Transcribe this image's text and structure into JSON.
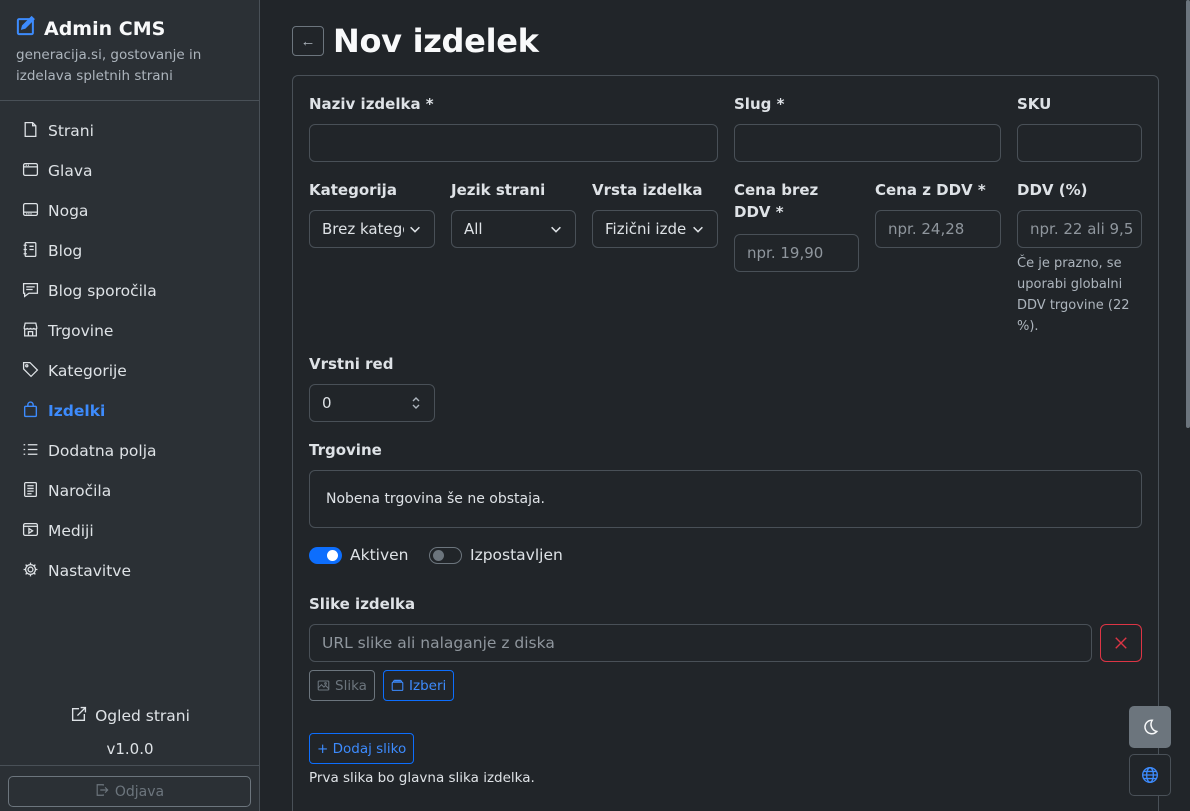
{
  "sidebar": {
    "brand_title": "Admin CMS",
    "brand_subtitle": "generacija.si, gostovanje in izdelava spletnih strani",
    "items": [
      {
        "label": "Strani",
        "icon": "file-icon"
      },
      {
        "label": "Glava",
        "icon": "window-icon"
      },
      {
        "label": "Noga",
        "icon": "window-dots-icon"
      },
      {
        "label": "Blog",
        "icon": "journal-icon"
      },
      {
        "label": "Blog sporočila",
        "icon": "chat-icon"
      },
      {
        "label": "Trgovine",
        "icon": "shop-icon"
      },
      {
        "label": "Kategorije",
        "icon": "tags-icon"
      },
      {
        "label": "Izdelki",
        "icon": "bag-icon",
        "active": true
      },
      {
        "label": "Dodatna polja",
        "icon": "list-icon"
      },
      {
        "label": "Naročila",
        "icon": "receipt-icon"
      },
      {
        "label": "Mediji",
        "icon": "play-icon"
      },
      {
        "label": "Nastavitve",
        "icon": "gear-icon"
      }
    ],
    "preview_label": "Ogled strani",
    "version": "v1.0.0",
    "logout_label": "Odjava"
  },
  "header": {
    "back_symbol": "←",
    "title": "Nov izdelek"
  },
  "form": {
    "name_label": "Naziv izdelka *",
    "name_value": "",
    "slug_label": "Slug *",
    "slug_value": "",
    "sku_label": "SKU",
    "sku_value": "",
    "category_label": "Kategorija",
    "category_value": "Brez kategorije",
    "language_label": "Jezik strani",
    "language_value": "All",
    "type_label": "Vrsta izdelka",
    "type_value": "Fizični izdelek",
    "price_net_label": "Cena brez DDV *",
    "price_net_placeholder": "npr. 19,90",
    "price_gross_label": "Cena z DDV *",
    "price_gross_placeholder": "npr. 24,28",
    "vat_label": "DDV (%)",
    "vat_placeholder": "npr. 22 ali 9,5",
    "vat_hint": "Če je prazno, se uporabi globalni DDV trgovine (22 %).",
    "order_label": "Vrstni red",
    "order_value": "0",
    "stores_label": "Trgovine",
    "stores_empty": "Nobena trgovina še ne obstaja.",
    "active_label": "Aktiven",
    "active_on": true,
    "featured_label": "Izpostavljen",
    "featured_on": false,
    "images_label": "Slike izdelka",
    "image_url_placeholder": "URL slike ali nalaganje z diska",
    "image_button_label": "Slika",
    "choose_button_label": "Izberi",
    "add_image_label": "+ Dodaj sliko",
    "images_hint": "Prva slika bo glavna slika izdelka."
  },
  "colors": {
    "accent": "#0d6efd",
    "danger": "#dc3545",
    "background": "#212529",
    "sidebar": "#2b3035"
  }
}
